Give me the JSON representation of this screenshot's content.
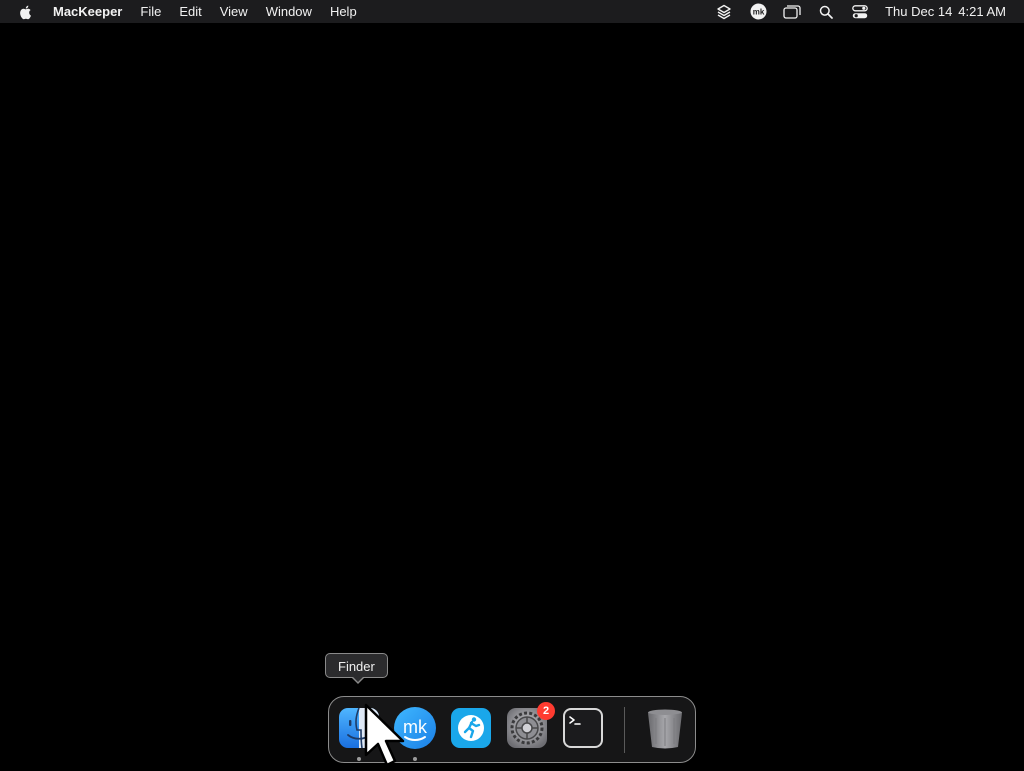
{
  "menubar": {
    "apple_icon": "apple-icon",
    "app_name": "MacKeeper",
    "menus": [
      "File",
      "Edit",
      "View",
      "Window",
      "Help"
    ],
    "status_icons": [
      "layers-icon",
      "mackeeper-icon",
      "screen-mirroring-icon",
      "spotlight-search-icon",
      "control-center-icon"
    ],
    "date": "Thu Dec 14",
    "time": "4:21 AM"
  },
  "tooltip": {
    "label": "Finder"
  },
  "dock": {
    "apps": [
      {
        "name": "Finder",
        "icon": "finder-icon",
        "running": true
      },
      {
        "name": "MacKeeper",
        "icon": "mackeeper-icon",
        "running": true
      },
      {
        "name": "Fitness",
        "icon": "running-figure-icon",
        "running": false
      },
      {
        "name": "System Settings",
        "icon": "settings-gear-icon",
        "running": false,
        "badge": "2"
      },
      {
        "name": "Terminal",
        "icon": "terminal-icon",
        "running": false
      }
    ],
    "trash": {
      "name": "Trash",
      "icon": "trash-icon"
    }
  }
}
